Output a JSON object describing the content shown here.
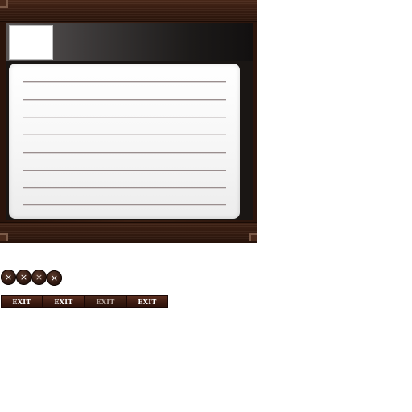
{
  "close_buttons": [
    {
      "glyph": "×",
      "state": "normal"
    },
    {
      "glyph": "×",
      "state": "hover"
    },
    {
      "glyph": "×",
      "state": "pressed"
    },
    {
      "glyph": "×",
      "state": "disabled"
    }
  ],
  "exit_buttons": [
    {
      "label": "EXIT",
      "state": "normal"
    },
    {
      "label": "EXIT",
      "state": "hover"
    },
    {
      "label": "EXIT",
      "state": "disabled"
    },
    {
      "label": "EXIT",
      "state": "pressed"
    }
  ],
  "colors": {
    "wood_dark": "#2a140b",
    "wood_light": "#4c2a1a",
    "panel": "#f5f5f5",
    "rule_line": "#9a8e8e",
    "button_text": "#ffffff"
  }
}
